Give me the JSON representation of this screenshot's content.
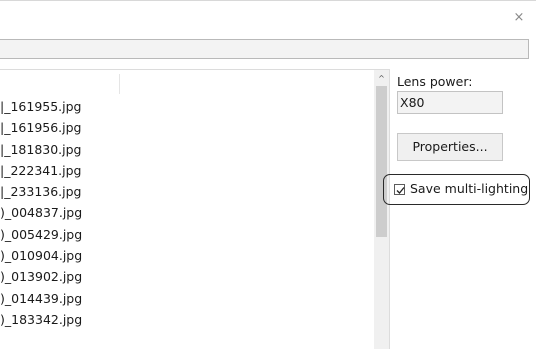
{
  "window": {
    "close_icon": "×"
  },
  "file_list": {
    "items": [
      "|_161955.jpg",
      "|_161956.jpg",
      "|_181830.jpg",
      "|_222341.jpg",
      "|_233136.jpg",
      ")_004837.jpg",
      ")_005429.jpg",
      ")_010904.jpg",
      ")_013902.jpg",
      ")_014439.jpg",
      ")_183342.jpg"
    ],
    "scroll_up_icon": "^"
  },
  "right_panel": {
    "lens_power_label": "Lens power:",
    "lens_power_value": "X80",
    "properties_label": "Properties...",
    "save_multi_lighting_label": "Save multi-lighting",
    "save_multi_lighting_checked": true
  }
}
